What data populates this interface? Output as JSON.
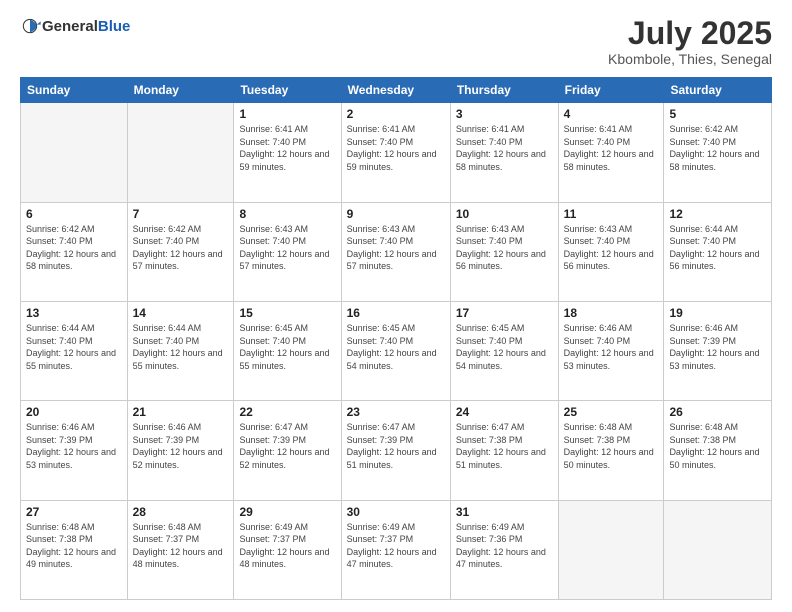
{
  "header": {
    "logo_general": "General",
    "logo_blue": "Blue",
    "month": "July 2025",
    "location": "Kbombole, Thies, Senegal"
  },
  "weekdays": [
    "Sunday",
    "Monday",
    "Tuesday",
    "Wednesday",
    "Thursday",
    "Friday",
    "Saturday"
  ],
  "weeks": [
    [
      {
        "day": "",
        "sunrise": "",
        "sunset": "",
        "daylight": "",
        "empty": true
      },
      {
        "day": "",
        "sunrise": "",
        "sunset": "",
        "daylight": "",
        "empty": true
      },
      {
        "day": "1",
        "sunrise": "Sunrise: 6:41 AM",
        "sunset": "Sunset: 7:40 PM",
        "daylight": "Daylight: 12 hours and 59 minutes.",
        "empty": false
      },
      {
        "day": "2",
        "sunrise": "Sunrise: 6:41 AM",
        "sunset": "Sunset: 7:40 PM",
        "daylight": "Daylight: 12 hours and 59 minutes.",
        "empty": false
      },
      {
        "day": "3",
        "sunrise": "Sunrise: 6:41 AM",
        "sunset": "Sunset: 7:40 PM",
        "daylight": "Daylight: 12 hours and 58 minutes.",
        "empty": false
      },
      {
        "day": "4",
        "sunrise": "Sunrise: 6:41 AM",
        "sunset": "Sunset: 7:40 PM",
        "daylight": "Daylight: 12 hours and 58 minutes.",
        "empty": false
      },
      {
        "day": "5",
        "sunrise": "Sunrise: 6:42 AM",
        "sunset": "Sunset: 7:40 PM",
        "daylight": "Daylight: 12 hours and 58 minutes.",
        "empty": false
      }
    ],
    [
      {
        "day": "6",
        "sunrise": "Sunrise: 6:42 AM",
        "sunset": "Sunset: 7:40 PM",
        "daylight": "Daylight: 12 hours and 58 minutes.",
        "empty": false
      },
      {
        "day": "7",
        "sunrise": "Sunrise: 6:42 AM",
        "sunset": "Sunset: 7:40 PM",
        "daylight": "Daylight: 12 hours and 57 minutes.",
        "empty": false
      },
      {
        "day": "8",
        "sunrise": "Sunrise: 6:43 AM",
        "sunset": "Sunset: 7:40 PM",
        "daylight": "Daylight: 12 hours and 57 minutes.",
        "empty": false
      },
      {
        "day": "9",
        "sunrise": "Sunrise: 6:43 AM",
        "sunset": "Sunset: 7:40 PM",
        "daylight": "Daylight: 12 hours and 57 minutes.",
        "empty": false
      },
      {
        "day": "10",
        "sunrise": "Sunrise: 6:43 AM",
        "sunset": "Sunset: 7:40 PM",
        "daylight": "Daylight: 12 hours and 56 minutes.",
        "empty": false
      },
      {
        "day": "11",
        "sunrise": "Sunrise: 6:43 AM",
        "sunset": "Sunset: 7:40 PM",
        "daylight": "Daylight: 12 hours and 56 minutes.",
        "empty": false
      },
      {
        "day": "12",
        "sunrise": "Sunrise: 6:44 AM",
        "sunset": "Sunset: 7:40 PM",
        "daylight": "Daylight: 12 hours and 56 minutes.",
        "empty": false
      }
    ],
    [
      {
        "day": "13",
        "sunrise": "Sunrise: 6:44 AM",
        "sunset": "Sunset: 7:40 PM",
        "daylight": "Daylight: 12 hours and 55 minutes.",
        "empty": false
      },
      {
        "day": "14",
        "sunrise": "Sunrise: 6:44 AM",
        "sunset": "Sunset: 7:40 PM",
        "daylight": "Daylight: 12 hours and 55 minutes.",
        "empty": false
      },
      {
        "day": "15",
        "sunrise": "Sunrise: 6:45 AM",
        "sunset": "Sunset: 7:40 PM",
        "daylight": "Daylight: 12 hours and 55 minutes.",
        "empty": false
      },
      {
        "day": "16",
        "sunrise": "Sunrise: 6:45 AM",
        "sunset": "Sunset: 7:40 PM",
        "daylight": "Daylight: 12 hours and 54 minutes.",
        "empty": false
      },
      {
        "day": "17",
        "sunrise": "Sunrise: 6:45 AM",
        "sunset": "Sunset: 7:40 PM",
        "daylight": "Daylight: 12 hours and 54 minutes.",
        "empty": false
      },
      {
        "day": "18",
        "sunrise": "Sunrise: 6:46 AM",
        "sunset": "Sunset: 7:40 PM",
        "daylight": "Daylight: 12 hours and 53 minutes.",
        "empty": false
      },
      {
        "day": "19",
        "sunrise": "Sunrise: 6:46 AM",
        "sunset": "Sunset: 7:39 PM",
        "daylight": "Daylight: 12 hours and 53 minutes.",
        "empty": false
      }
    ],
    [
      {
        "day": "20",
        "sunrise": "Sunrise: 6:46 AM",
        "sunset": "Sunset: 7:39 PM",
        "daylight": "Daylight: 12 hours and 53 minutes.",
        "empty": false
      },
      {
        "day": "21",
        "sunrise": "Sunrise: 6:46 AM",
        "sunset": "Sunset: 7:39 PM",
        "daylight": "Daylight: 12 hours and 52 minutes.",
        "empty": false
      },
      {
        "day": "22",
        "sunrise": "Sunrise: 6:47 AM",
        "sunset": "Sunset: 7:39 PM",
        "daylight": "Daylight: 12 hours and 52 minutes.",
        "empty": false
      },
      {
        "day": "23",
        "sunrise": "Sunrise: 6:47 AM",
        "sunset": "Sunset: 7:39 PM",
        "daylight": "Daylight: 12 hours and 51 minutes.",
        "empty": false
      },
      {
        "day": "24",
        "sunrise": "Sunrise: 6:47 AM",
        "sunset": "Sunset: 7:38 PM",
        "daylight": "Daylight: 12 hours and 51 minutes.",
        "empty": false
      },
      {
        "day": "25",
        "sunrise": "Sunrise: 6:48 AM",
        "sunset": "Sunset: 7:38 PM",
        "daylight": "Daylight: 12 hours and 50 minutes.",
        "empty": false
      },
      {
        "day": "26",
        "sunrise": "Sunrise: 6:48 AM",
        "sunset": "Sunset: 7:38 PM",
        "daylight": "Daylight: 12 hours and 50 minutes.",
        "empty": false
      }
    ],
    [
      {
        "day": "27",
        "sunrise": "Sunrise: 6:48 AM",
        "sunset": "Sunset: 7:38 PM",
        "daylight": "Daylight: 12 hours and 49 minutes.",
        "empty": false
      },
      {
        "day": "28",
        "sunrise": "Sunrise: 6:48 AM",
        "sunset": "Sunset: 7:37 PM",
        "daylight": "Daylight: 12 hours and 48 minutes.",
        "empty": false
      },
      {
        "day": "29",
        "sunrise": "Sunrise: 6:49 AM",
        "sunset": "Sunset: 7:37 PM",
        "daylight": "Daylight: 12 hours and 48 minutes.",
        "empty": false
      },
      {
        "day": "30",
        "sunrise": "Sunrise: 6:49 AM",
        "sunset": "Sunset: 7:37 PM",
        "daylight": "Daylight: 12 hours and 47 minutes.",
        "empty": false
      },
      {
        "day": "31",
        "sunrise": "Sunrise: 6:49 AM",
        "sunset": "Sunset: 7:36 PM",
        "daylight": "Daylight: 12 hours and 47 minutes.",
        "empty": false
      },
      {
        "day": "",
        "sunrise": "",
        "sunset": "",
        "daylight": "",
        "empty": true
      },
      {
        "day": "",
        "sunrise": "",
        "sunset": "",
        "daylight": "",
        "empty": true
      }
    ]
  ]
}
